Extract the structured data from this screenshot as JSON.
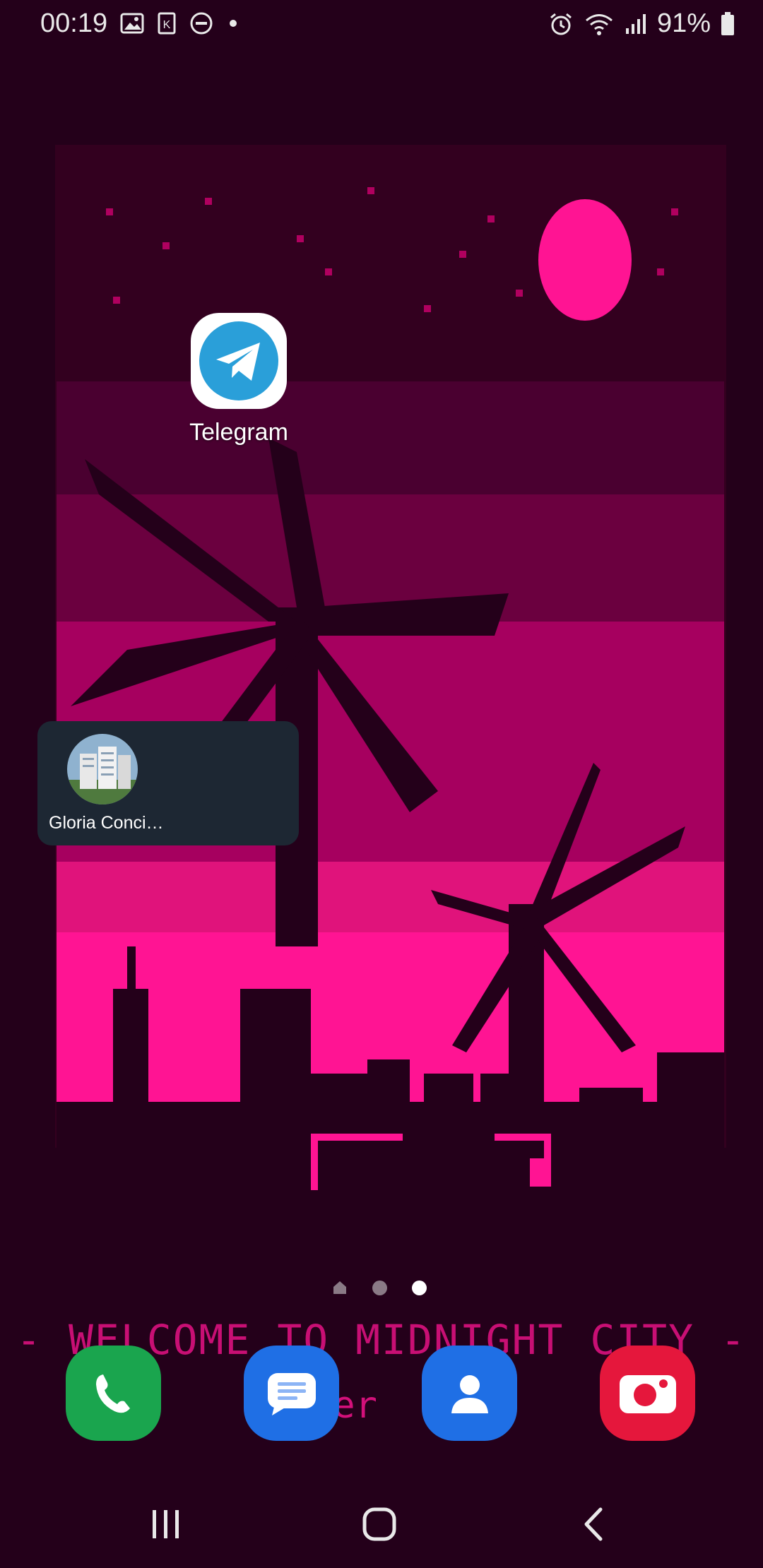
{
  "status_bar": {
    "time": "00:19",
    "battery": "91%",
    "left_icons": [
      "image-icon",
      "sim-k-icon",
      "do-not-disturb-icon",
      "dot-icon"
    ],
    "right_icons": [
      "alarm-icon",
      "wifi-icon",
      "signal-icon",
      "battery-icon"
    ]
  },
  "home": {
    "apps": [
      {
        "label": "Telegram",
        "icon": "telegram-icon"
      }
    ],
    "widget": {
      "label": "Gloria Conci…",
      "icon": "contact-avatar"
    },
    "page_indicator": {
      "pages": [
        "home",
        "page-2",
        "page-3"
      ],
      "active_index": 2
    }
  },
  "wallpaper": {
    "text": "- WELCOME TO MIDNIGHT CITY -",
    "subtext": "ter",
    "colors": {
      "background": "#24001a",
      "accent": "#ff1493",
      "moon": "#ff1493"
    }
  },
  "dock": {
    "apps": [
      {
        "name": "Phone",
        "icon": "phone-icon",
        "color": "#1aa54e"
      },
      {
        "name": "Messages",
        "icon": "messages-icon",
        "color": "#1f6fe5"
      },
      {
        "name": "Contacts",
        "icon": "contacts-icon",
        "color": "#1f6fe5"
      },
      {
        "name": "Camera",
        "icon": "camera-icon",
        "color": "#e5173c"
      }
    ]
  },
  "nav_bar": {
    "buttons": [
      "recents-button",
      "home-button",
      "back-button"
    ]
  }
}
